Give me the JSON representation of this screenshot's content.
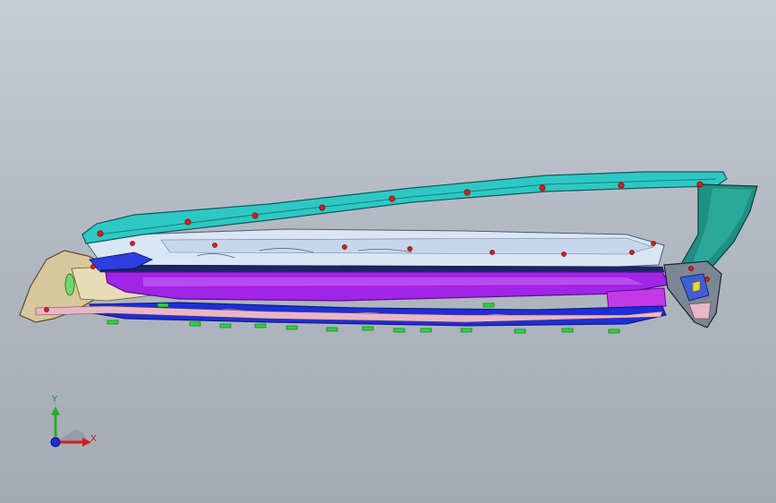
{
  "viewport": {
    "background_top": "#c7ccd5",
    "background_bottom": "#a4aab4"
  },
  "colors": {
    "teal_rail": "#2ec8c4",
    "teal_dark": "#1f8f84",
    "glass_light": "#d9e6f4",
    "purple_panel": "#a025e6",
    "blue_rail": "#1c2fd8",
    "fastener_red": "#e01a1a",
    "clip_green": "#27d93b",
    "tan_frame": "#d8c79a"
  },
  "triad": {
    "x_label": "X",
    "y_label": "Y",
    "x_color": "#d41c1c",
    "y_color": "#22b022",
    "z_color": "#1c2ce0"
  }
}
